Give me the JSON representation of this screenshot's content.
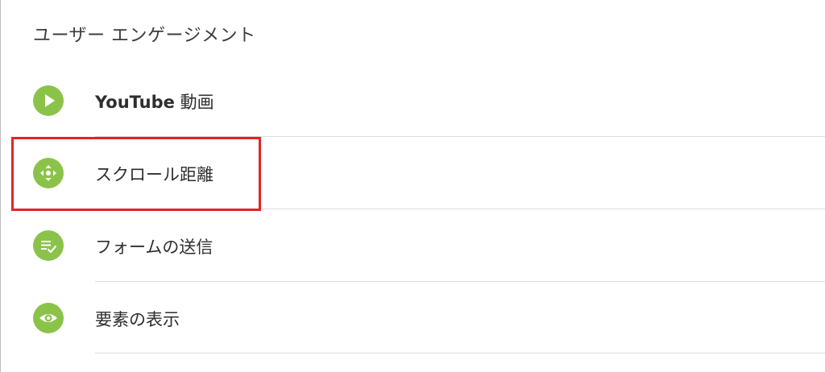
{
  "section": {
    "title": "ユーザー エンゲージメント"
  },
  "items": [
    {
      "label_lead": "YouTube",
      "label_rest": " 動画",
      "icon": "play-icon"
    },
    {
      "label": "スクロール距離",
      "icon": "move-arrows-icon"
    },
    {
      "label": "フォームの送信",
      "icon": "list-check-icon"
    },
    {
      "label": "要素の表示",
      "icon": "eye-icon"
    }
  ],
  "colors": {
    "icon_bg": "#8bc34a",
    "highlight": "#e32424",
    "divider": "#dcdcdc"
  }
}
